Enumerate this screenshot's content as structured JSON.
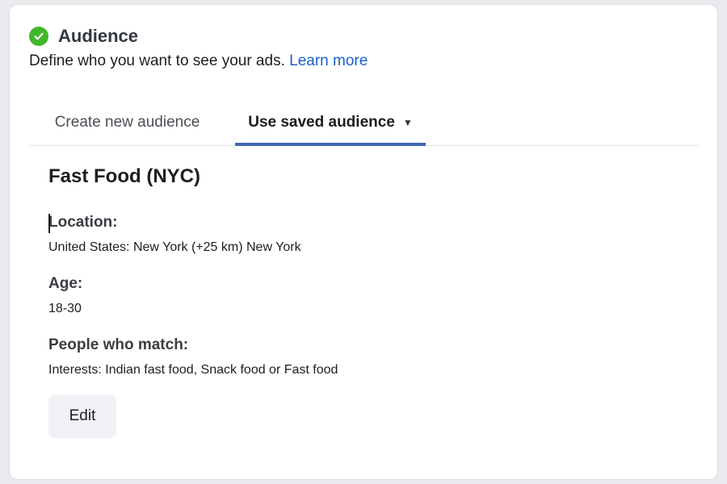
{
  "colors": {
    "accent": "#4267b2",
    "success": "#42b72a"
  },
  "header": {
    "title": "Audience",
    "description": "Define who you want to see your ads.",
    "learn_more": "Learn more",
    "status_icon": "check-circle-icon"
  },
  "tabs": [
    {
      "label": "Create new audience",
      "active": false
    },
    {
      "label": "Use saved audience",
      "active": true,
      "icon": "caret-down-icon"
    }
  ],
  "audience": {
    "name": "Fast Food (NYC)",
    "sections": [
      {
        "label": "Location:",
        "value": "United States: New York (+25 km) New York"
      },
      {
        "label": "Age:",
        "value": "18-30"
      },
      {
        "label": "People who match:",
        "value": "Interests: Indian fast food, Snack food or Fast food"
      }
    ],
    "edit_label": "Edit"
  }
}
